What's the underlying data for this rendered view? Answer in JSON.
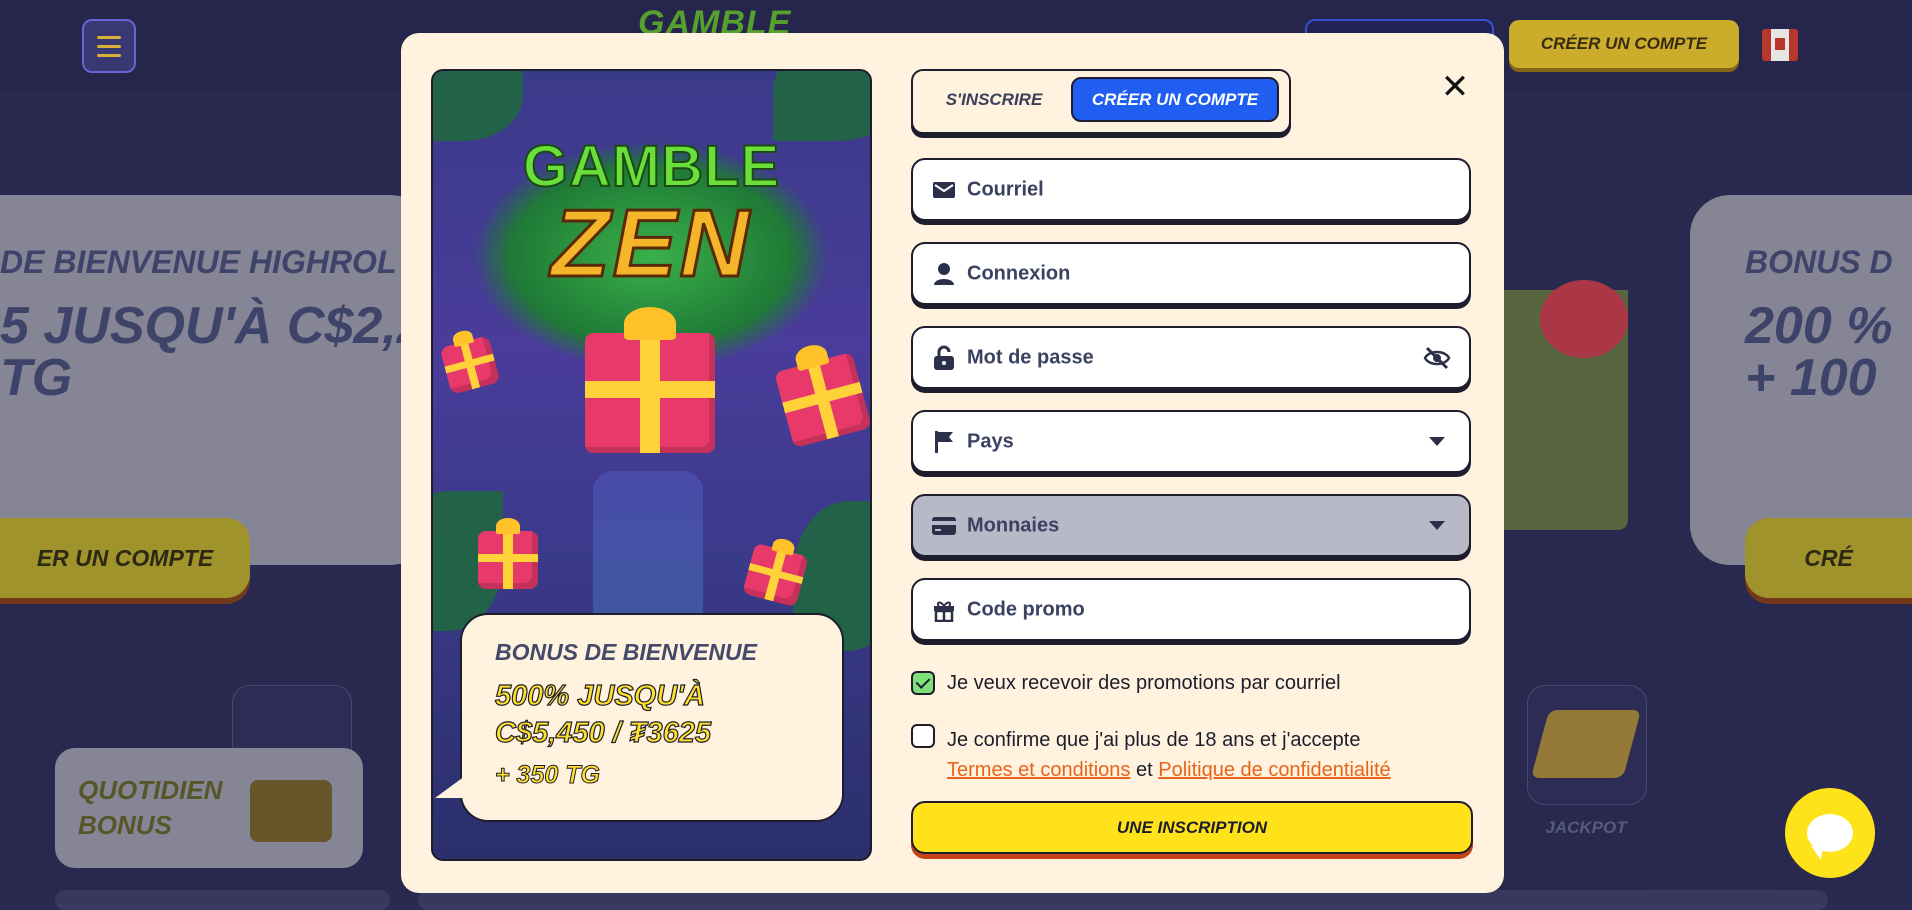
{
  "background": {
    "header": {
      "logo": "GAMBLE",
      "create_account_label": "CRÉER UN COMPTE"
    },
    "banner_left": {
      "line1": "DE BIENVENUE HIGHROL",
      "line2": "5 JUSQU'À C$2,2",
      "line3": "TG",
      "button": "ER UN COMPTE"
    },
    "banner_right": {
      "line1": "BONUS D",
      "line2": "200 %",
      "line3": "+ 100",
      "button": "CRÉ"
    },
    "daily_bonus": {
      "line1": "QUOTIDIEN",
      "line2": "BONUS"
    },
    "jackpot_label": "JACKPOT"
  },
  "modal": {
    "promo": {
      "logo_line1": "GAMBLE",
      "logo_line2": "ZEN",
      "card_title": "BONUS DE BIENVENUE",
      "card_amount_line1": "500% JUSQU'À",
      "card_amount_line2": "C$5,450 / ₮3625",
      "card_tg": "+ 350 TG"
    },
    "tabs": {
      "login": "S'INSCRIRE",
      "create": "CRÉER UN COMPTE",
      "active": "create"
    },
    "close_icon": "close-icon",
    "fields": {
      "email": {
        "label": "Courriel",
        "icon": "envelope-icon"
      },
      "login": {
        "label": "Connexion",
        "icon": "user-icon"
      },
      "password": {
        "label": "Mot de passe",
        "icon": "lock-icon",
        "trail_icon": "eye-off-icon"
      },
      "country": {
        "label": "Pays",
        "icon": "flag-icon"
      },
      "currency": {
        "label": "Monnaies",
        "icon": "card-icon"
      },
      "promo": {
        "label": "Code promo",
        "icon": "gift-icon"
      }
    },
    "checkbox_promotions": {
      "label": "Je veux recevoir des promotions par courriel",
      "checked": true
    },
    "checkbox_terms": {
      "label_start": "Je confirme que j'ai plus de 18 ans et j'accepte",
      "link1": "Termes et conditions",
      "and": "et",
      "link2": "Politique de confidentialité",
      "checked": false
    },
    "submit_label": "UNE INSCRIPTION"
  },
  "colors": {
    "accent_blue": "#1f5ef0",
    "submit_yellow": "#ffe21a",
    "link_orange": "#e8641a",
    "modal_bg": "#fff3df"
  }
}
